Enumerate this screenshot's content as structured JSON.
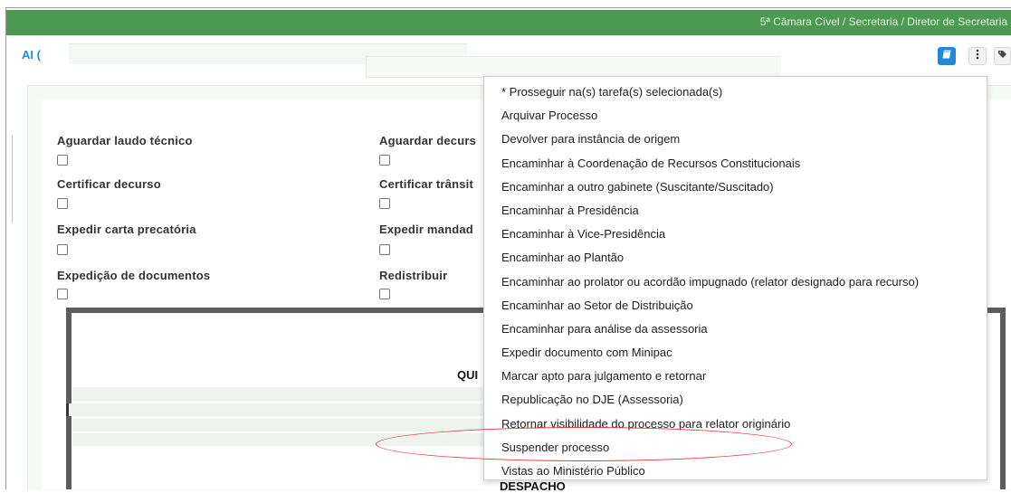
{
  "header": {
    "breadcrumb": "5ª Câmara Cível / Secretaria / Diretor de Secretaria",
    "brand_text": "AI ("
  },
  "colors": {
    "topbar": "#4c9a52",
    "primary_button": "#1f89d6",
    "highlight": "#e23b3b"
  },
  "icons": [
    "book-icon",
    "more-vertical-icon",
    "tag-icon"
  ],
  "tasks": [
    {
      "label": "Aguardar laudo técnico",
      "checked": false
    },
    {
      "label": "Aguardar decurs",
      "checked": false
    },
    {
      "label": "Certificar decurso",
      "checked": false
    },
    {
      "label": "Certificar trânsit",
      "checked": false
    },
    {
      "label": "Expedir carta precatória",
      "checked": false
    },
    {
      "label": "Expedir mandad",
      "checked": false
    },
    {
      "label": "Expedição de documentos",
      "checked": false
    },
    {
      "label": "Redistribuir",
      "checked": false
    }
  ],
  "document": {
    "title_fragment": "QUI",
    "bottom_fragment": "DESPACHO"
  },
  "menu": {
    "items": [
      "* Prosseguir na(s) tarefa(s) selecionada(s)",
      "Arquivar Processo",
      "Devolver para instância de origem",
      "Encaminhar à Coordenação de Recursos Constitucionais",
      "Encaminhar a outro gabinete (Suscitante/Suscitado)",
      "Encaminhar à Presidência",
      "Encaminhar à Vice-Presidência",
      "Encaminhar ao Plantão",
      "Encaminhar ao prolator ou acordão impugnado (relator designado para recurso)",
      "Encaminhar ao Setor de Distribuição",
      "Encaminhar para análise da assessoria",
      "Expedir documento com Minipac",
      "Marcar apto para julgamento e retornar",
      "Republicação no DJE (Assessoria)",
      "Retornar visibilidade do processo para relator originário",
      "Suspender processo",
      "Vistas ao Ministério Público"
    ],
    "highlighted_item": "Suspender processo"
  }
}
